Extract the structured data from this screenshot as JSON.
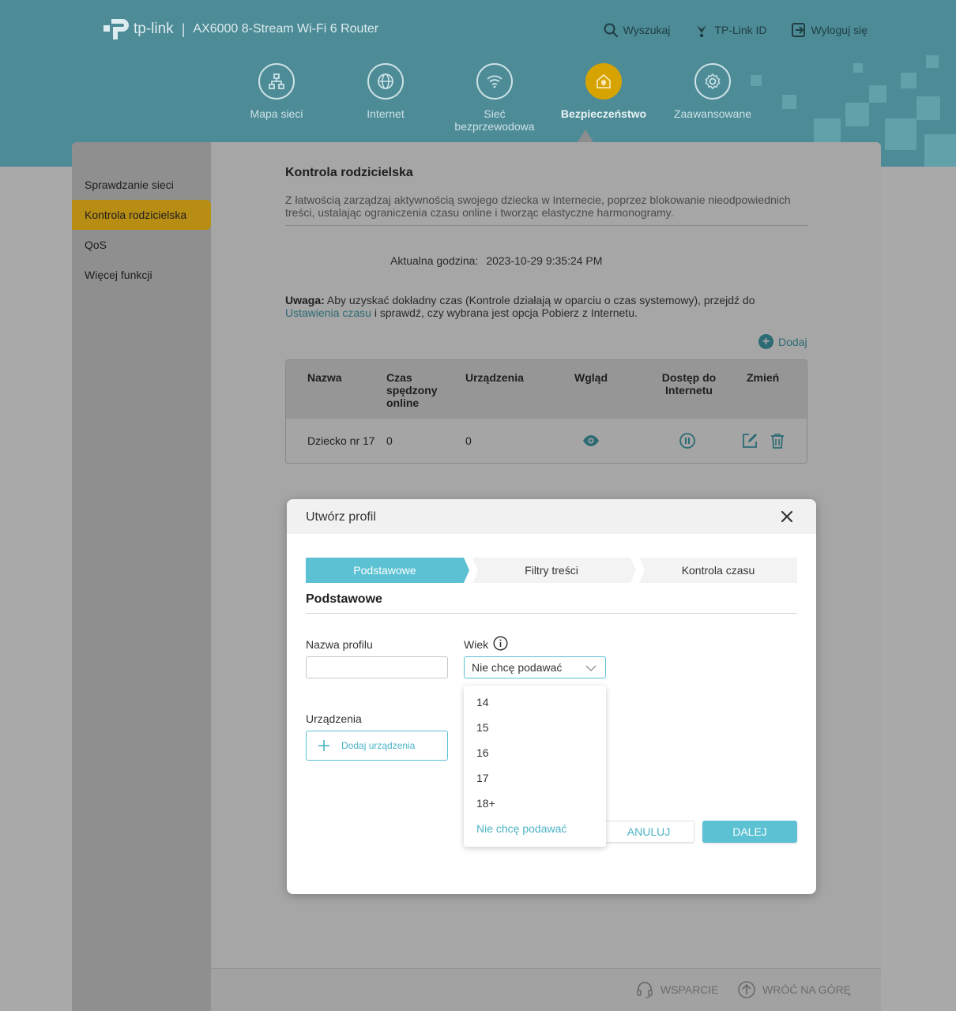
{
  "header": {
    "logo_text": "tp-link",
    "separator": "|",
    "model": "AX6000 8-Stream Wi-Fi 6 Router",
    "links": [
      {
        "label": "Wyszukaj",
        "icon": "search-icon"
      },
      {
        "label": "TP-Link ID",
        "icon": "tplink-id-icon"
      },
      {
        "label": "Wyloguj się",
        "icon": "logout-icon"
      }
    ],
    "nav": [
      {
        "label": "Mapa sieci",
        "icon": "network-map-icon"
      },
      {
        "label": "Internet",
        "icon": "globe-icon"
      },
      {
        "label": "Sieć bezprzewodowa",
        "icon": "wifi-icon"
      },
      {
        "label": "Bezpieczeństwo",
        "icon": "security-home-icon",
        "active": true
      },
      {
        "label": "Zaawansowane",
        "icon": "advanced-gear-icon"
      }
    ]
  },
  "sidebar": {
    "items": [
      {
        "label": "Sprawdzanie sieci"
      },
      {
        "label": "Kontrola rodzicielska",
        "active": true
      },
      {
        "label": "QoS"
      },
      {
        "label": "Więcej funkcji"
      }
    ]
  },
  "main": {
    "title": "Kontrola rodzicielska",
    "description": "Z łatwością zarządzaj aktywnością swojego dziecka w Internecie, poprzez blokowanie nieodpowiednich treści, ustalając ograniczenia czasu online i tworząc elastyczne harmonogramy.",
    "time_label": "Aktualna godzina:",
    "time_value": "2023-10-29 9:35:24 PM",
    "note_label": "Uwaga:",
    "note_text_1": " Aby uzyskać dokładny czas (Kontrole działają w oparciu o czas systemowy), przejdź do ",
    "note_link": "Ustawienia czasu",
    "note_text_2": " i sprawdź, czy wybrana jest opcja Pobierz z Internetu.",
    "add_label": "Dodaj",
    "table": {
      "headers": [
        "Nazwa",
        "Czas spędzony online",
        "Urządzenia",
        "Wgląd",
        "Dostęp do Internetu",
        "Zmień"
      ],
      "rows": [
        {
          "name": "Dziecko nr 17",
          "time_online": "0",
          "devices": "0"
        }
      ]
    }
  },
  "footer": {
    "support": "WSPARCIE",
    "back_to_top": "WRÓĆ NA GÓRĘ"
  },
  "modal": {
    "title": "Utwórz profil",
    "steps": [
      "Podstawowe",
      "Filtry treści",
      "Kontrola czasu"
    ],
    "active_step": 0,
    "section_title": "Podstawowe",
    "profile_name_label": "Nazwa profilu",
    "profile_name_value": "",
    "age_label": "Wiek",
    "age_selected": "Nie chcę podawać",
    "age_options": [
      "14",
      "15",
      "16",
      "17",
      "18+",
      "Nie chcę podawać"
    ],
    "devices_label": "Urządzenia",
    "add_devices_label": "Dodaj urządzenia",
    "cancel_label": "ANULUJ",
    "next_label": "DALEJ"
  },
  "colors": {
    "header_bg": "#4d8b96",
    "accent": "#5bc1d3",
    "active_nav": "#d7a300",
    "sidebar_active": "#b88d14"
  }
}
